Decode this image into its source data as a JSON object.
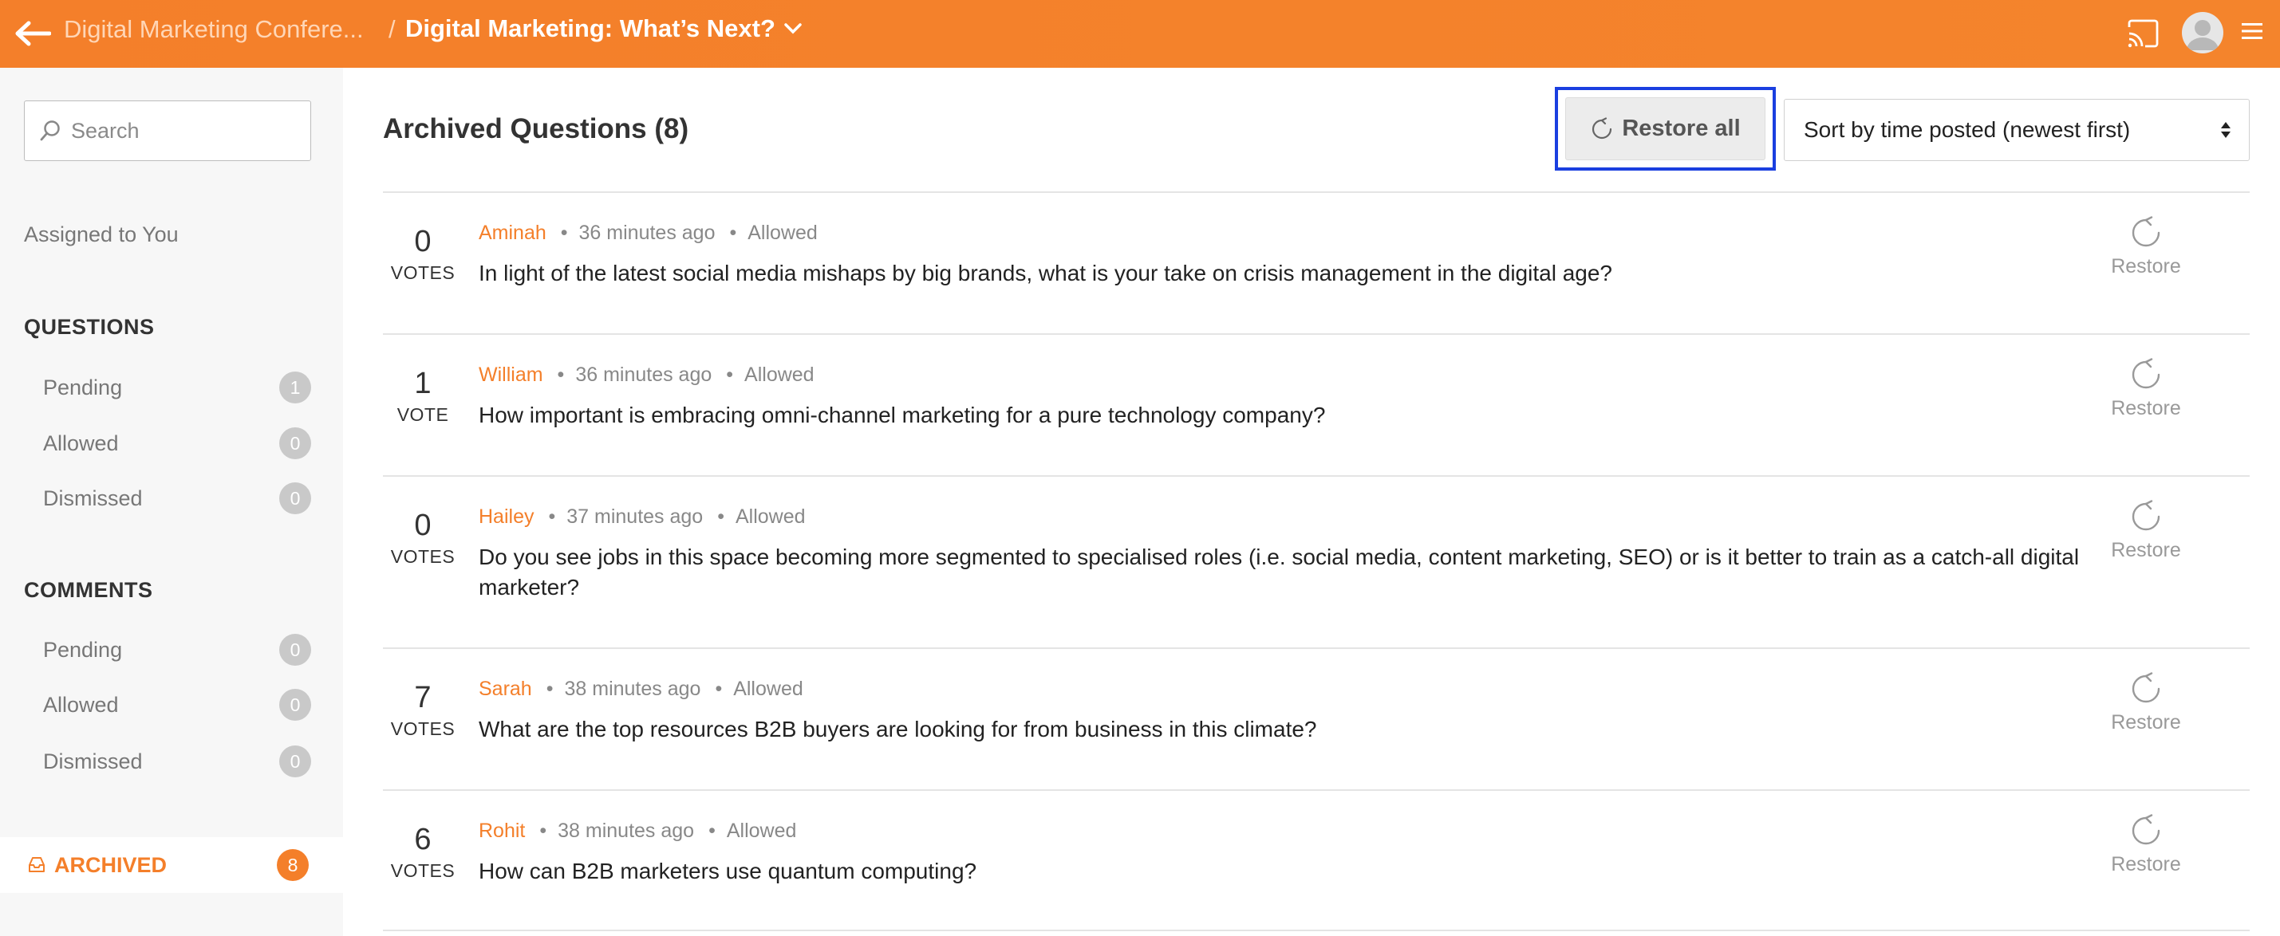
{
  "header": {
    "parent_crumb": "Digital Marketing Confere...",
    "separator": "/",
    "current_title": "Digital Marketing: What’s Next?"
  },
  "sidebar": {
    "search_placeholder": "Search",
    "assigned": "Assigned to You",
    "questions_title": "QUESTIONS",
    "questions": [
      {
        "label": "Pending",
        "count": "1"
      },
      {
        "label": "Allowed",
        "count": "0"
      },
      {
        "label": "Dismissed",
        "count": "0"
      }
    ],
    "comments_title": "COMMENTS",
    "comments": [
      {
        "label": "Pending",
        "count": "0"
      },
      {
        "label": "Allowed",
        "count": "0"
      },
      {
        "label": "Dismissed",
        "count": "0"
      }
    ],
    "archived": {
      "label": "ARCHIVED",
      "count": "8"
    }
  },
  "main": {
    "title": "Archived Questions (8)",
    "restore_all": "Restore all",
    "sort_label": "Sort by time posted (newest first)",
    "questions": [
      {
        "votes": "0",
        "unit": "VOTES",
        "author": "Aminah",
        "time": "36 minutes ago",
        "status": "Allowed",
        "text": "In light of the latest social media mishaps by big brands, what is your take on crisis management in the digital age?",
        "restore": "Restore"
      },
      {
        "votes": "1",
        "unit": "VOTE",
        "author": "William",
        "time": "36 minutes ago",
        "status": "Allowed",
        "text": "How important is embracing omni-channel marketing for a pure technology company?",
        "restore": "Restore"
      },
      {
        "votes": "0",
        "unit": "VOTES",
        "author": "Hailey",
        "time": "37 minutes ago",
        "status": "Allowed",
        "text": "Do you see jobs in this space becoming more segmented to specialised roles (i.e. social media, content marketing, SEO) or is it better to train as a catch-all digital marketer?",
        "restore": "Restore"
      },
      {
        "votes": "7",
        "unit": "VOTES",
        "author": "Sarah",
        "time": "38 minutes ago",
        "status": "Allowed",
        "text": "What are the top resources B2B buyers are looking for from business in this climate?",
        "restore": "Restore"
      },
      {
        "votes": "6",
        "unit": "VOTES",
        "author": "Rohit",
        "time": "38 minutes ago",
        "status": "Allowed",
        "text": "How can B2B marketers use quantum computing?",
        "restore": "Restore"
      }
    ]
  },
  "colors": {
    "accent": "#f47f2a",
    "highlight": "#1a3fe0"
  },
  "icons": [
    "back-arrow-icon",
    "chevron-down-icon",
    "cast-icon",
    "avatar-icon",
    "hamburger-menu-icon",
    "search-icon",
    "archive-icon",
    "restore-icon",
    "sort-arrows-icon"
  ]
}
